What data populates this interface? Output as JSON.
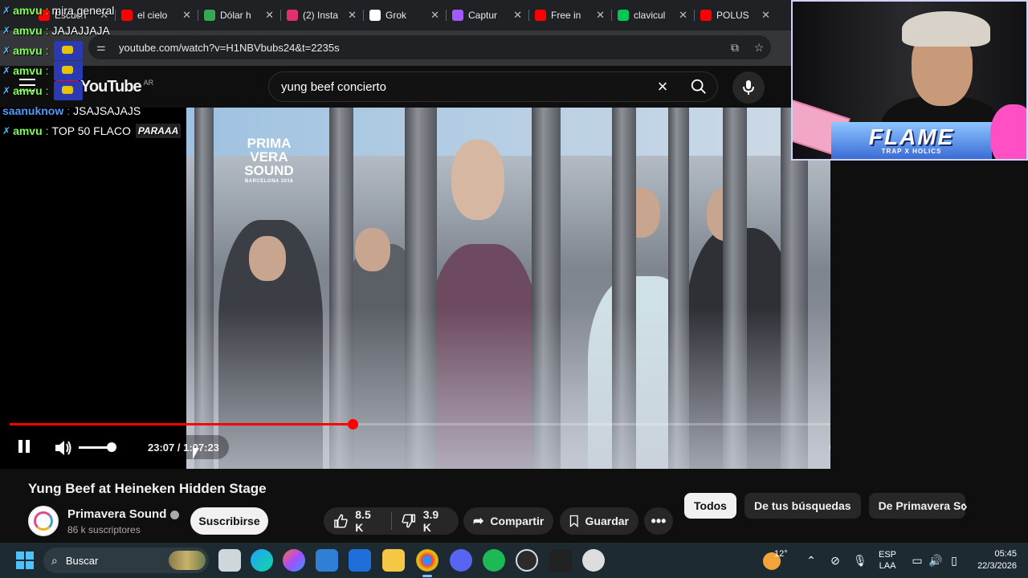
{
  "browser": {
    "tabs": [
      {
        "title": "Escuch",
        "color": "#ff0000"
      },
      {
        "title": "el cielo",
        "color": "#ff0000"
      },
      {
        "title": "Dólar h",
        "color": "#34a853"
      },
      {
        "title": "(2) Insta",
        "color": "#e1306c"
      },
      {
        "title": "Grok",
        "color": "#ffffff"
      },
      {
        "title": "Captur",
        "color": "#a259ff"
      },
      {
        "title": "Free in",
        "color": "#ff0000"
      },
      {
        "title": "clavicul",
        "color": "#00c853"
      },
      {
        "title": "POLUS",
        "color": "#ff0000"
      }
    ],
    "url": "youtube.com/watch?v=H1NBVbubs24&t=2235s"
  },
  "youtube": {
    "logo_text": "YouTube",
    "country": "AR",
    "search_query": "yung beef concierto"
  },
  "chat": [
    {
      "user": "amvu",
      "text": "mira general",
      "color": "#7cff4f"
    },
    {
      "user": "amvu",
      "text": "JAJAJJAJA",
      "color": "#7cff4f"
    },
    {
      "user": "amvu",
      "text": "",
      "color": "#7cff4f",
      "emote": true
    },
    {
      "user": "amvu",
      "text": "",
      "color": "#7cff4f",
      "emote": true
    },
    {
      "user": "amvu",
      "text": "",
      "color": "#7cff4f",
      "emote": true
    },
    {
      "user": "saanuknow",
      "text": "JSAJSAJAJS",
      "color": "#4f9bff"
    },
    {
      "user": "amvu",
      "text": "TOP 50 FLACO",
      "color": "#7cff4f",
      "badge": "PARAAA"
    }
  ],
  "video": {
    "watermark": "PRIMA VERA SOUND",
    "watermark_sub": "BARCELONA 2018",
    "current_time": "23:07",
    "duration": "1:07:23",
    "progress_fraction": 0.344,
    "volume_fraction": 0.9
  },
  "webcam": {
    "overlay_title": "FLAME",
    "overlay_sub": "TRAP X HOLICS"
  },
  "details": {
    "title": "Yung Beef at Heineken Hidden Stage",
    "channel": "Primavera Sound",
    "subscribers": "86 k suscriptores",
    "subscribe_label": "Suscribirse",
    "likes": "8.5 K",
    "dislikes": "3.9 K",
    "share_label": "Compartir",
    "save_label": "Guardar"
  },
  "chips": [
    "Todos",
    "De tus búsquedas",
    "De Primavera Sound"
  ],
  "taskbar": {
    "search_placeholder": "Buscar",
    "temperature": "12°",
    "lang_top": "ESP",
    "lang_bottom": "LAA",
    "time": "05:45",
    "date": "22/3/2026"
  },
  "colors": {
    "progress": "#ff0000",
    "accent_blue": "#4cc2ff"
  }
}
